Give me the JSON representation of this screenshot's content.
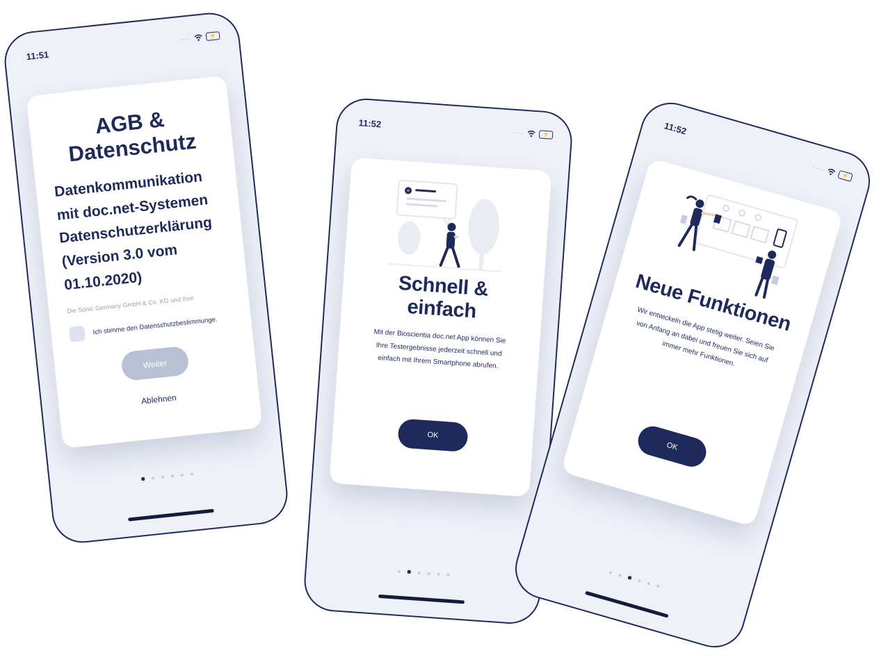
{
  "phones": [
    {
      "time": "11:51",
      "title": "AGB & Datenschutz",
      "subtitle": "Datenkommunikation mit doc.net-Systemen Datenschutzerklärung (Version 3.0 vom 01.10.2020)",
      "small_text": "Die Sonic Germany GmbH & Co. KG und Ihre",
      "checkbox_label": "Ich stimme den Datenschutzbestimmunge.",
      "checkbox_checked": false,
      "button_label": "Weiter",
      "link_label": "Ablehnen",
      "page_count": 6,
      "active_page": 1
    },
    {
      "time": "11:52",
      "title": "Schnell & einfach",
      "body": "Mit der Bioscientia doc.net App können Sie Ihre Testergebnisse jederzeit schnell und einfach mit Ihrem Smartphone abrufen.",
      "button_label": "OK",
      "page_count": 6,
      "active_page": 2
    },
    {
      "time": "11:52",
      "title": "Neue Funktionen",
      "body": "Wir entwickeln die App stetig weiter. Seien Sie von Anfang an dabei und freuen Sie sich auf immer mehr Funktionen.",
      "button_label": "OK",
      "page_count": 6,
      "active_page": 3
    }
  ],
  "colors": {
    "navy": "#1f2a5c",
    "screen_bg": "#eef1f8",
    "disabled_button": "#b8c0d6"
  },
  "icons": [
    "wifi-icon",
    "battery-charging-icon",
    "illustration-person-chat",
    "illustration-people-dashboard"
  ]
}
